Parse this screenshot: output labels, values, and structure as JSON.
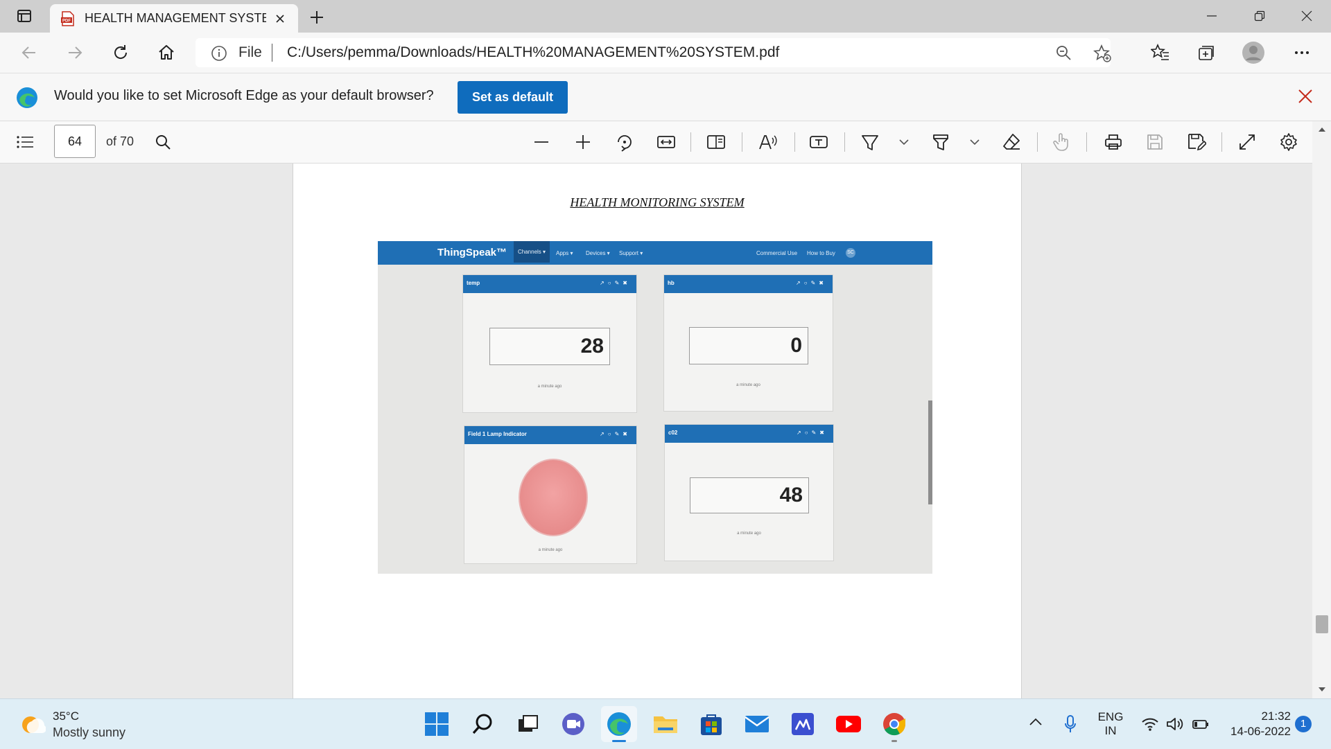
{
  "browser": {
    "tab_title": "HEALTH MANAGEMENT SYSTEM",
    "address_scheme": "File",
    "address_url": "C:/Users/pemma/Downloads/HEALTH%20MANAGEMENT%20SYSTEM.pdf"
  },
  "infobar": {
    "message": "Would you like to set Microsoft Edge as your default browser?",
    "button_label": "Set as default"
  },
  "pdf_toolbar": {
    "page_number": "64",
    "page_total": "of 70"
  },
  "document": {
    "heading": "HEALTH MONITORING SYSTEM",
    "photo": {
      "brand": "ThingSpeak™",
      "nav_items": [
        "Channels ▾",
        "Apps ▾",
        "Devices ▾",
        "Support ▾"
      ],
      "nav_right": [
        "Commercial Use",
        "How to Buy"
      ],
      "avatar": "SC",
      "widgets": [
        {
          "title": "temp",
          "value": "28",
          "ago": "a minute ago"
        },
        {
          "title": "hb",
          "value": "0",
          "ago": "a minute ago"
        },
        {
          "title": "Field 1 Lamp Indicator",
          "ago": "a minute ago"
        },
        {
          "title": "c02",
          "value": "48",
          "ago": "a minute ago"
        }
      ],
      "widget_icons": "↗○✎✖"
    }
  },
  "taskbar": {
    "weather_temp": "35°C",
    "weather_desc": "Mostly sunny",
    "lang_top": "ENG",
    "lang_bottom": "IN",
    "time": "21:32",
    "date": "14-06-2022",
    "notification_count": "1"
  }
}
